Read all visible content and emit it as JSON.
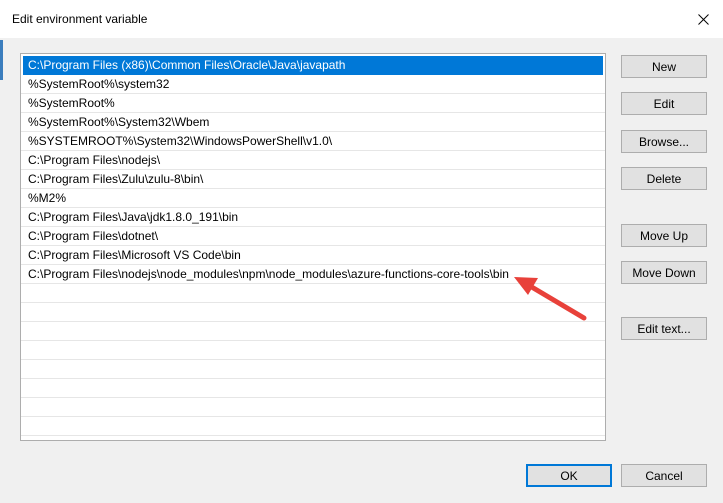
{
  "window": {
    "title": "Edit environment variable"
  },
  "list": {
    "items": [
      {
        "label": "C:\\Program Files (x86)\\Common Files\\Oracle\\Java\\javapath"
      },
      {
        "label": "%SystemRoot%\\system32"
      },
      {
        "label": "%SystemRoot%"
      },
      {
        "label": "%SystemRoot%\\System32\\Wbem"
      },
      {
        "label": "%SYSTEMROOT%\\System32\\WindowsPowerShell\\v1.0\\"
      },
      {
        "label": "C:\\Program Files\\nodejs\\"
      },
      {
        "label": "C:\\Program Files\\Zulu\\zulu-8\\bin\\"
      },
      {
        "label": "%M2%"
      },
      {
        "label": "C:\\Program Files\\Java\\jdk1.8.0_191\\bin"
      },
      {
        "label": "C:\\Program Files\\dotnet\\"
      },
      {
        "label": "C:\\Program Files\\Microsoft VS Code\\bin"
      },
      {
        "label": "C:\\Program Files\\nodejs\\node_modules\\npm\\node_modules\\azure-functions-core-tools\\bin"
      }
    ],
    "selected_index": 0
  },
  "buttons": {
    "new": "New",
    "edit": "Edit",
    "browse": "Browse...",
    "delete": "Delete",
    "move_up": "Move Up",
    "move_down": "Move Down",
    "edit_text": "Edit text...",
    "ok": "OK",
    "cancel": "Cancel"
  },
  "colors": {
    "selection": "#0078d7",
    "annotation_arrow": "#e8413a"
  }
}
